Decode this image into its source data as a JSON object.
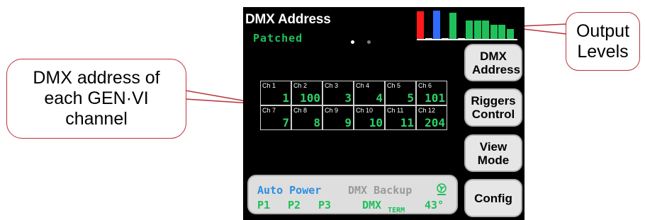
{
  "callouts": {
    "left": "DMX address of each GEN·VI channel",
    "right": "Output Levels"
  },
  "screen": {
    "title": "DMX Address",
    "status": "Patched",
    "page_indicator": {
      "pages": 2,
      "active": 1
    },
    "output_levels": {
      "colors": [
        "#ff1a1a",
        "#2e6bff",
        "#1fc05a"
      ],
      "bars": [
        {
          "level": 0.98,
          "color": "#ff1a1a"
        },
        {
          "level": 0.03,
          "color": "#ffffff"
        },
        {
          "level": 1.0,
          "color": "#2e6bff"
        },
        {
          "level": 0.03,
          "color": "#ffffff"
        },
        {
          "level": 0.93,
          "color": "#1fc05a"
        },
        {
          "level": 0.03,
          "color": "#ffffff"
        },
        {
          "level": 0.66,
          "color": "#1fc05a"
        },
        {
          "level": 0.66,
          "color": "#1fc05a"
        },
        {
          "level": 0.66,
          "color": "#1fc05a"
        },
        {
          "level": 0.5,
          "color": "#1fc05a"
        },
        {
          "level": 0.5,
          "color": "#1fc05a"
        },
        {
          "level": 0.34,
          "color": "#1fc05a"
        }
      ]
    },
    "channels": [
      {
        "label": "Ch 1",
        "value": "1"
      },
      {
        "label": "Ch 2",
        "value": "100"
      },
      {
        "label": "Ch 3",
        "value": "3"
      },
      {
        "label": "Ch 4",
        "value": "4"
      },
      {
        "label": "Ch 5",
        "value": "5"
      },
      {
        "label": "Ch 6",
        "value": "101"
      },
      {
        "label": "Ch 7",
        "value": "7"
      },
      {
        "label": "Ch 8",
        "value": "8"
      },
      {
        "label": "Ch 9",
        "value": "9"
      },
      {
        "label": "Ch 10",
        "value": "10"
      },
      {
        "label": "Ch 11",
        "value": "11"
      },
      {
        "label": "Ch 12",
        "value": "204"
      }
    ],
    "buttons": {
      "dmx_address": "DMX Address",
      "riggers_control": "Riggers Control",
      "view_mode": "View Mode",
      "config": "Config"
    },
    "panel": {
      "auto_power": "Auto Power",
      "dmx_backup": "DMX Backup",
      "p1": "P1",
      "p2": "P2",
      "p3": "P3",
      "dmx": "DMX",
      "term": "TERM",
      "temperature": "43°",
      "fan_icon": "fan-icon"
    }
  }
}
